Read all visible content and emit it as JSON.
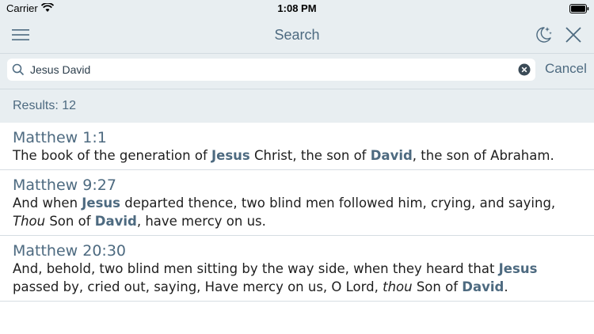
{
  "status_bar": {
    "carrier": "Carrier",
    "time": "1:08 PM"
  },
  "nav": {
    "title": "Search",
    "icons": [
      "menu-icon",
      "night-mode-icon",
      "close-icon"
    ]
  },
  "search": {
    "value": "Jesus David",
    "placeholder": "Search",
    "cancel_label": "Cancel"
  },
  "results": {
    "count_label": "Results: 12",
    "items": [
      {
        "reference": "Matthew 1:1",
        "segments": [
          {
            "text": "The book of the generation of ",
            "style": "normal"
          },
          {
            "text": "Jesus",
            "style": "highlight"
          },
          {
            "text": " Christ, the son of ",
            "style": "normal"
          },
          {
            "text": "David",
            "style": "highlight"
          },
          {
            "text": ", the son of Abraham.",
            "style": "normal"
          }
        ]
      },
      {
        "reference": "Matthew 9:27",
        "segments": [
          {
            "text": "And when ",
            "style": "normal"
          },
          {
            "text": "Jesus",
            "style": "highlight"
          },
          {
            "text": " departed thence, two blind men followed him, crying, and saying, ",
            "style": "normal"
          },
          {
            "text": "Thou",
            "style": "italic"
          },
          {
            "text": " Son of ",
            "style": "normal"
          },
          {
            "text": "David",
            "style": "highlight"
          },
          {
            "text": ", have mercy on us.",
            "style": "normal"
          }
        ]
      },
      {
        "reference": "Matthew 20:30",
        "segments": [
          {
            "text": "And, behold, two blind men sitting by the way side, when they heard that ",
            "style": "normal"
          },
          {
            "text": "Jesus",
            "style": "highlight"
          },
          {
            "text": " passed by, cried out, saying, Have mercy on us, O Lord, ",
            "style": "normal"
          },
          {
            "text": "thou",
            "style": "italic"
          },
          {
            "text": " Son of ",
            "style": "normal"
          },
          {
            "text": "David",
            "style": "highlight"
          },
          {
            "text": ".",
            "style": "normal"
          }
        ]
      }
    ]
  },
  "colors": {
    "accent": "#4d6a80",
    "bar_background": "#e8eef1"
  }
}
